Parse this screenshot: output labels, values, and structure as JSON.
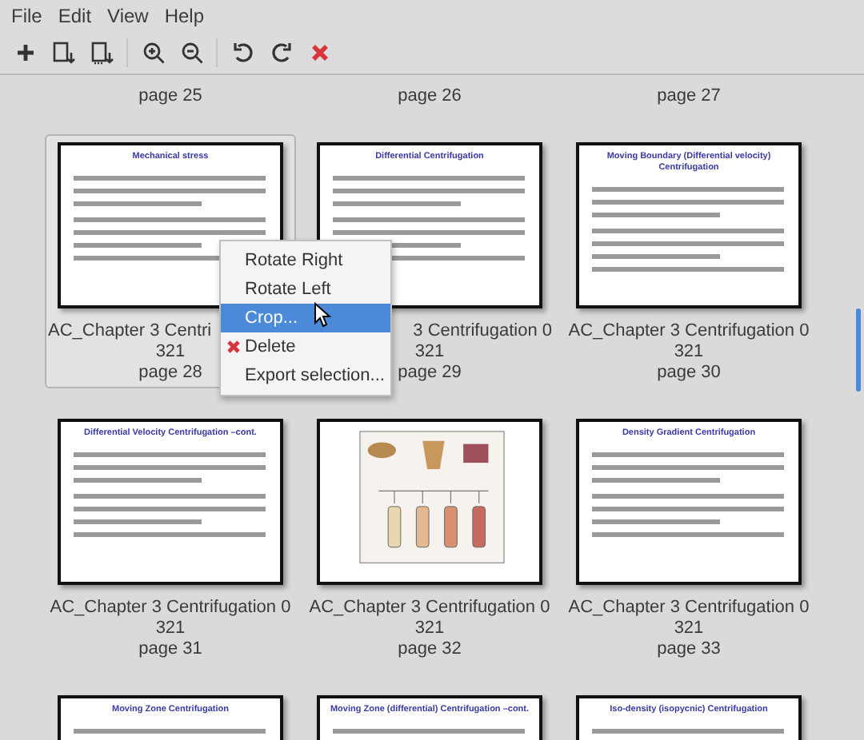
{
  "menu_bar": [
    "File",
    "Edit",
    "View",
    "Help"
  ],
  "toolbar": [
    {
      "kind": "add"
    },
    {
      "kind": "import"
    },
    {
      "kind": "import_after"
    },
    {
      "kind": "separator"
    },
    {
      "kind": "zoom_in"
    },
    {
      "kind": "zoom_out"
    },
    {
      "kind": "separator"
    },
    {
      "kind": "rotate_left"
    },
    {
      "kind": "rotate_right"
    },
    {
      "kind": "delete"
    }
  ],
  "pages": [
    {
      "selected": false,
      "lines": [
        {
          "text": "page 25"
        }
      ]
    },
    {
      "selected": false,
      "lines": [
        {
          "text": "page 26"
        }
      ]
    },
    {
      "selected": false,
      "lines": [
        {
          "text": "page 27"
        }
      ]
    },
    {
      "selected": true,
      "thumbnail": {
        "kind": "slide",
        "title": "Mechanical stress"
      },
      "lines": [
        {
          "text": "AC_Chapter 3 Centri",
          "covered_end": true
        },
        {
          "text": "321"
        },
        {
          "text": "page 28"
        }
      ]
    },
    {
      "selected": false,
      "thumbnail": {
        "kind": "slide",
        "title": "Differential Centrifugation"
      },
      "lines": [
        {
          "text": "3 Centrifugation 0",
          "covered_start": true
        },
        {
          "text": "321"
        },
        {
          "text": "page 29"
        }
      ]
    },
    {
      "selected": false,
      "thumbnail": {
        "kind": "slide",
        "title": "Moving Boundary (Differential velocity) Centrifugation"
      },
      "lines": [
        {
          "text": "AC_Chapter 3 Centrifugation 0"
        },
        {
          "text": "321"
        },
        {
          "text": "page 30"
        }
      ]
    },
    {
      "selected": false,
      "thumbnail": {
        "kind": "slide",
        "title": "Differential Velocity Centrifugation –cont."
      },
      "lines": [
        {
          "text": "AC_Chapter 3 Centrifugation 0"
        },
        {
          "text": "321"
        },
        {
          "text": "page 31"
        }
      ]
    },
    {
      "selected": false,
      "thumbnail": {
        "kind": "diagram"
      },
      "lines": [
        {
          "text": "AC_Chapter 3 Centrifugation 0"
        },
        {
          "text": "321"
        },
        {
          "text": "page 32"
        }
      ]
    },
    {
      "selected": false,
      "thumbnail": {
        "kind": "slide",
        "title": "Density Gradient Centrifugation"
      },
      "lines": [
        {
          "text": "AC_Chapter 3 Centrifugation 0"
        },
        {
          "text": "321"
        },
        {
          "text": "page 33"
        }
      ]
    },
    {
      "selected": false,
      "thumbnail": {
        "kind": "slide",
        "title": "Moving Zone Centrifugation"
      }
    },
    {
      "selected": false,
      "thumbnail": {
        "kind": "slide",
        "title": "Moving Zone (differential) Centrifugation –cont."
      }
    },
    {
      "selected": false,
      "thumbnail": {
        "kind": "slide",
        "title": "Iso-density (isopycnic) Centrifugation"
      }
    }
  ],
  "context_menu": [
    {
      "label": "Rotate Right",
      "selected": false
    },
    {
      "label": "Rotate Left",
      "selected": false
    },
    {
      "label": "Crop...",
      "selected": true
    },
    {
      "label": "Delete",
      "selected": false,
      "kind": "delete"
    },
    {
      "label": "Export selection...",
      "selected": false
    }
  ]
}
